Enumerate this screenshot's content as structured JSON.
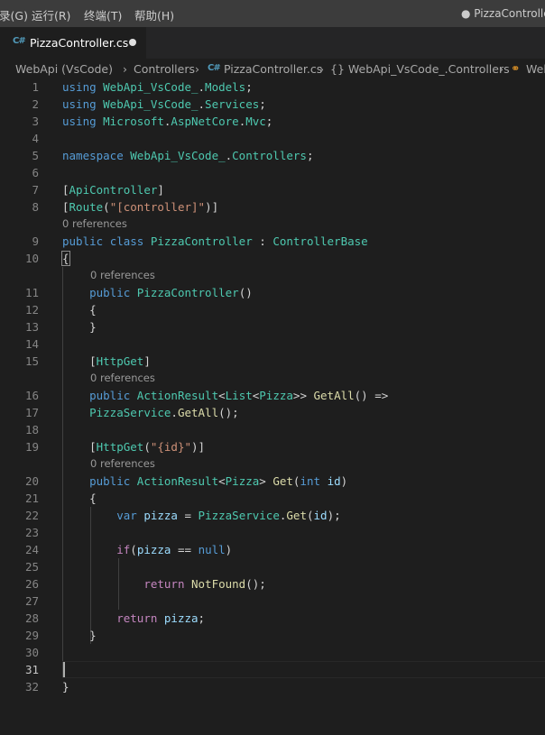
{
  "menubar": {
    "items": [
      "录(G)",
      "运行(R)",
      "终端(T)",
      "帮助(H)"
    ],
    "window_title": "● PizzaController."
  },
  "tab": {
    "icon": "C#",
    "label": "PizzaController.cs"
  },
  "breadcrumb": {
    "items": [
      "WebApi  (VsCode)",
      "Controllers",
      "PizzaController.cs",
      "{} WebApi_VsCode_.Controllers",
      "WebA"
    ]
  },
  "lens": {
    "zero_refs": "0 references"
  },
  "line_numbers": [
    "1",
    "2",
    "3",
    "4",
    "5",
    "6",
    "7",
    "8",
    "9",
    "10",
    "11",
    "12",
    "13",
    "14",
    "15",
    "16",
    "17",
    "18",
    "19",
    "20",
    "21",
    "22",
    "23",
    "24",
    "25",
    "26",
    "27",
    "28",
    "29",
    "30",
    "31",
    "32"
  ],
  "code": [
    [
      [
        "k",
        "using "
      ],
      [
        "t",
        "WebApi_VsCode_"
      ],
      [
        "p",
        "."
      ],
      [
        "t",
        "Models"
      ],
      [
        "p",
        ";"
      ]
    ],
    [
      [
        "k",
        "using "
      ],
      [
        "t",
        "WebApi_VsCode_"
      ],
      [
        "p",
        "."
      ],
      [
        "t",
        "Services"
      ],
      [
        "p",
        ";"
      ]
    ],
    [
      [
        "k",
        "using "
      ],
      [
        "t",
        "Microsoft"
      ],
      [
        "p",
        "."
      ],
      [
        "t",
        "AspNetCore"
      ],
      [
        "p",
        "."
      ],
      [
        "t",
        "Mvc"
      ],
      [
        "p",
        ";"
      ]
    ],
    [],
    [
      [
        "k",
        "namespace "
      ],
      [
        "t",
        "WebApi_VsCode_"
      ],
      [
        "p",
        "."
      ],
      [
        "t",
        "Controllers"
      ],
      [
        "p",
        ";"
      ]
    ],
    [],
    [
      [
        "p",
        "["
      ],
      [
        "t",
        "ApiController"
      ],
      [
        "p",
        "]"
      ]
    ],
    [
      [
        "p",
        "["
      ],
      [
        "t",
        "Route"
      ],
      [
        "p",
        "("
      ],
      [
        "s",
        "\"[controller]\""
      ],
      [
        "p",
        ")]"
      ]
    ],
    [
      [
        "k",
        "public "
      ],
      [
        "k",
        "class "
      ],
      [
        "t",
        "PizzaController"
      ],
      [
        "p",
        " : "
      ],
      [
        "t",
        "ControllerBase"
      ]
    ],
    [
      [
        "p",
        "{"
      ]
    ],
    [
      [
        "p",
        "    "
      ],
      [
        "k",
        "public "
      ],
      [
        "t",
        "PizzaController"
      ],
      [
        "p",
        "()"
      ]
    ],
    [
      [
        "p",
        "    {"
      ]
    ],
    [
      [
        "p",
        "    }"
      ]
    ],
    [],
    [
      [
        "p",
        "    ["
      ],
      [
        "t",
        "HttpGet"
      ],
      [
        "p",
        "]"
      ]
    ],
    [
      [
        "p",
        "    "
      ],
      [
        "k",
        "public "
      ],
      [
        "t",
        "ActionResult"
      ],
      [
        "p",
        "<"
      ],
      [
        "t",
        "List"
      ],
      [
        "p",
        "<"
      ],
      [
        "t",
        "Pizza"
      ],
      [
        "p",
        ">> "
      ],
      [
        "f",
        "GetAll"
      ],
      [
        "p",
        "() =>"
      ]
    ],
    [
      [
        "p",
        "    "
      ],
      [
        "t",
        "PizzaService"
      ],
      [
        "p",
        "."
      ],
      [
        "f",
        "GetAll"
      ],
      [
        "p",
        "();"
      ]
    ],
    [],
    [
      [
        "p",
        "    ["
      ],
      [
        "t",
        "HttpGet"
      ],
      [
        "p",
        "("
      ],
      [
        "s",
        "\"{id}\""
      ],
      [
        "p",
        ")]"
      ]
    ],
    [
      [
        "p",
        "    "
      ],
      [
        "k",
        "public "
      ],
      [
        "t",
        "ActionResult"
      ],
      [
        "p",
        "<"
      ],
      [
        "t",
        "Pizza"
      ],
      [
        "p",
        "> "
      ],
      [
        "f",
        "Get"
      ],
      [
        "p",
        "("
      ],
      [
        "k",
        "int "
      ],
      [
        "v",
        "id"
      ],
      [
        "p",
        ")"
      ]
    ],
    [
      [
        "p",
        "    {"
      ]
    ],
    [
      [
        "p",
        "        "
      ],
      [
        "k",
        "var "
      ],
      [
        "v",
        "pizza"
      ],
      [
        "p",
        " = "
      ],
      [
        "t",
        "PizzaService"
      ],
      [
        "p",
        "."
      ],
      [
        "f",
        "Get"
      ],
      [
        "p",
        "("
      ],
      [
        "v",
        "id"
      ],
      [
        "p",
        ");"
      ]
    ],
    [],
    [
      [
        "p",
        "        "
      ],
      [
        "c",
        "if"
      ],
      [
        "p",
        "("
      ],
      [
        "v",
        "pizza"
      ],
      [
        "p",
        " == "
      ],
      [
        "k",
        "null"
      ],
      [
        "p",
        ")"
      ]
    ],
    [],
    [
      [
        "p",
        "            "
      ],
      [
        "c",
        "return "
      ],
      [
        "f",
        "NotFound"
      ],
      [
        "p",
        "();"
      ]
    ],
    [],
    [
      [
        "p",
        "        "
      ],
      [
        "c",
        "return "
      ],
      [
        "v",
        "pizza"
      ],
      [
        "p",
        ";"
      ]
    ],
    [
      [
        "p",
        "    }"
      ]
    ],
    [],
    [],
    [
      [
        "p",
        "}"
      ]
    ]
  ],
  "colors": {
    "keyword": "#569cd6",
    "type": "#4ec9b0",
    "function": "#dcdcaa",
    "string": "#ce9178",
    "variable": "#9cdcfe",
    "control": "#c586c0"
  }
}
